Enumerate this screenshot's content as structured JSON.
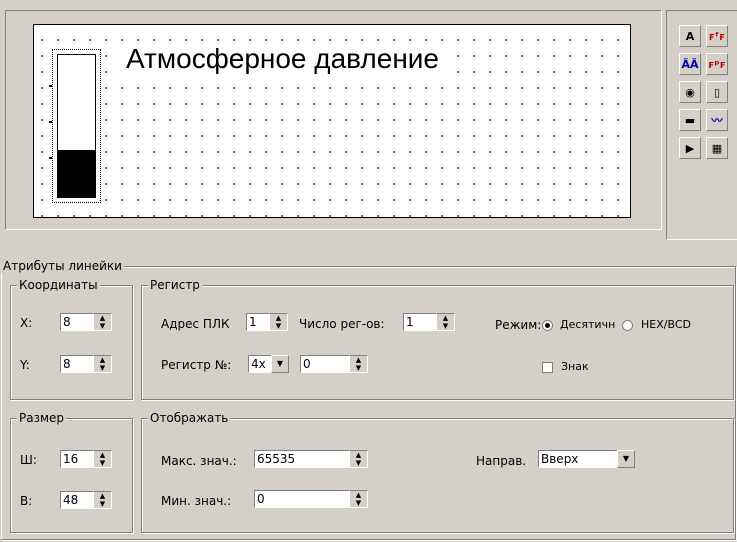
{
  "preview": {
    "title": "Атмосферное давление",
    "bar_fill_fraction": 0.33
  },
  "toolbox": {
    "tools": [
      {
        "glyph": "A",
        "icon": "text-icon"
      },
      {
        "glyph": "ꜰᶠꜰ",
        "icon": "font-icon"
      },
      {
        "glyph": "ÃÃ",
        "icon": "text-convert-icon"
      },
      {
        "glyph": "ꜰᵖꜰ",
        "icon": "font-properties-icon"
      },
      {
        "glyph": "◉",
        "icon": "lamp-icon"
      },
      {
        "glyph": "▯",
        "icon": "bar-graph-icon"
      },
      {
        "glyph": "▬",
        "icon": "number-display-icon"
      },
      {
        "glyph": "〰",
        "icon": "trend-icon"
      },
      {
        "glyph": "▶",
        "icon": "play-icon"
      },
      {
        "glyph": "▦",
        "icon": "grid-pattern-icon"
      }
    ]
  },
  "attributes": {
    "title": "Атрибуты линейки",
    "coords": {
      "title": "Координаты",
      "x_label": "X:",
      "x_value": "8",
      "y_label": "Y:",
      "y_value": "8"
    },
    "size": {
      "title": "Размер",
      "w_label": "Ш:",
      "w_value": "16",
      "h_label": "В:",
      "h_value": "48"
    },
    "register": {
      "title": "Регистр",
      "plc_addr_label": "Адрес ПЛК",
      "plc_addr_value": "1",
      "reg_count_label": "Число рег-ов:",
      "reg_count_value": "1",
      "mode_label": "Режим:",
      "mode_decimal": "Десятичн",
      "mode_hex": "HEX/BCD",
      "reg_no_label": "Регистр №:",
      "reg_type_value": "4x",
      "reg_no_value": "0",
      "sign_label": "Знак"
    },
    "display": {
      "title": "Отображать",
      "max_label": "Макс. знач.:",
      "max_value": "65535",
      "min_label": "Мин. знач.:",
      "min_value": "0",
      "direction_label": "Направ.",
      "direction_value": "Вверх"
    }
  },
  "colors": {
    "face": "#d4d0c8",
    "canvas": "#ffffff"
  }
}
